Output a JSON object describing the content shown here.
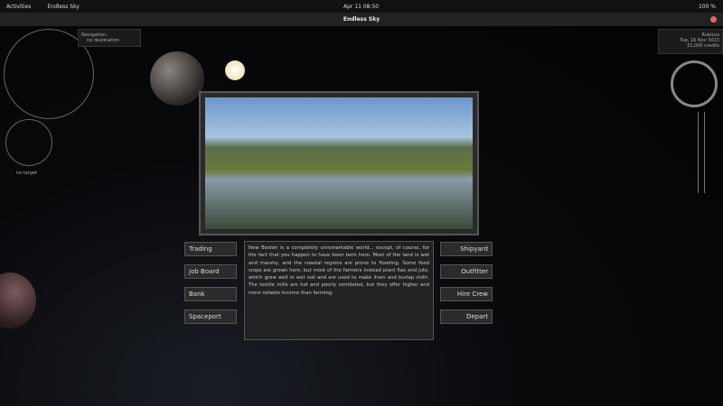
{
  "topbar": {
    "activities": "Activities",
    "app": "Endless Sky",
    "clock": "Apr 11  08:50",
    "battery": "100 %"
  },
  "window": {
    "title": "Endless Sky"
  },
  "hud": {
    "nav_label": "Navigation:",
    "nav_value": "no destination",
    "target": "no target",
    "ship_name": "Rubicus",
    "date": "Tue, 16 Nov 3013",
    "credits": "31,000 credits"
  },
  "buttons_left": [
    "Trading",
    "Job Board",
    "Bank",
    "Spaceport"
  ],
  "buttons_right": [
    "Shipyard",
    "Outfitter",
    "Hire Crew",
    "Depart"
  ],
  "description": "New Boston is a completely unremarkable world... except, of course, for the fact that you happen to have been born here. Most of the land is wet and marshy, and the coastal regions are prone to flooding. Some food crops are grown here, but most of the farmers instead plant flax and jute, which grow well in wet soil and are used to make linen and burlap cloth. The textile mills are hot and poorly ventilated, but they offer higher and more reliable income than farming."
}
